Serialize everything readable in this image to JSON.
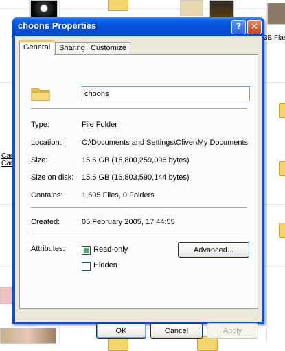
{
  "background": {
    "labels": [
      {
        "text": "3B Flas"
      },
      {
        "text": "Car"
      },
      {
        "text": "Car"
      }
    ]
  },
  "dialog": {
    "title": "choons Properties",
    "help_label": "?",
    "close_label": "✕",
    "tabs": [
      {
        "label": "General"
      },
      {
        "label": "Sharing"
      },
      {
        "label": "Customize"
      }
    ],
    "name_value": "choons",
    "fields": {
      "type_label": "Type:",
      "type_value": "File Folder",
      "location_label": "Location:",
      "location_value": "C:\\Documents and Settings\\Oliver\\My Documents",
      "size_label": "Size:",
      "size_value": "15.6 GB (16,800,259,096 bytes)",
      "size_on_disk_label": "Size on disk:",
      "size_on_disk_value": "15.6 GB (16,803,590,144 bytes)",
      "contains_label": "Contains:",
      "contains_value": "1,695 Files, 0 Folders",
      "created_label": "Created:",
      "created_value": "05 February 2005, 17:44:55",
      "attributes_label": "Attributes:"
    },
    "attributes": {
      "read_only_label": "Read-only",
      "read_only_checked": true,
      "hidden_label": "Hidden",
      "hidden_checked": false,
      "advanced_label": "Advanced..."
    },
    "buttons": {
      "ok": "OK",
      "cancel": "Cancel",
      "apply": "Apply"
    }
  },
  "colors": {
    "titlebar": "#0450d8",
    "client_bg": "#ece9d8",
    "checkbox_fill": "#3cb371"
  }
}
